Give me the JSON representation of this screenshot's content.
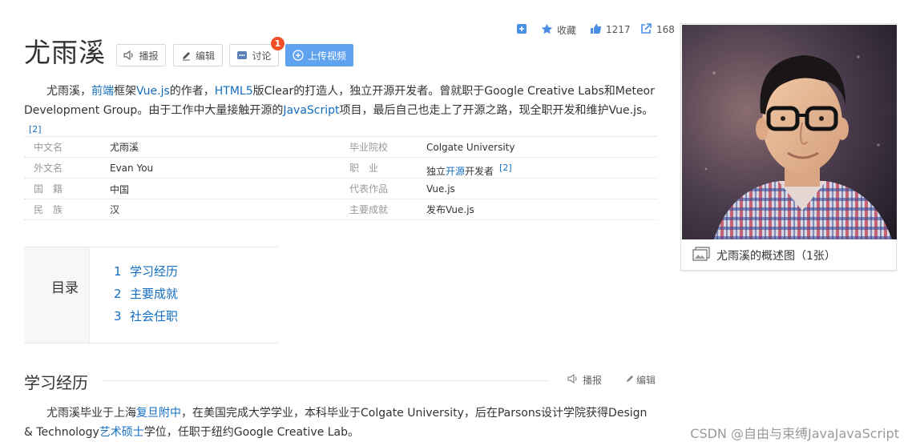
{
  "header": {
    "title": "尤雨溪",
    "buttons": {
      "broadcast": "播报",
      "edit": "编辑",
      "discuss": "讨论",
      "discuss_badge": "1",
      "upload_video": "上传视频"
    }
  },
  "topbar": {
    "favorite_label": "收藏",
    "like_count": "1217",
    "share_count": "168"
  },
  "summary": {
    "t1": "尤雨溪，",
    "l1": "前端",
    "t2": "框架",
    "l2": "Vue.js",
    "t3": "的作者，",
    "l3": "HTML5",
    "t4": "版Clear的打造人，独立开源开发者。曾就职于Google Creative Labs和Meteor Development Group。由于工作中大量接触开源的",
    "l4": "JavaScript",
    "t5": "项目，最后自己也走上了开源之路，现全职开发和维护Vue.js。",
    "ref": "[2]"
  },
  "info": {
    "rows": [
      {
        "k1": "中文名",
        "v1": "尤雨溪",
        "k2": "毕业院校",
        "v2": "Colgate University"
      },
      {
        "k1": "外文名",
        "v1": "Evan You",
        "k2": "职　业",
        "v2a": "独立",
        "v2link": "开源",
        "v2b": "开发者",
        "ref": "[2]"
      },
      {
        "k1": "国　籍",
        "v1": "中国",
        "k2": "代表作品",
        "v2": "Vue.js"
      },
      {
        "k1": "民　族",
        "v1": "汉",
        "k2": "主要成就",
        "v2": "发布Vue.js"
      }
    ]
  },
  "toc": {
    "title": "目录",
    "items": [
      {
        "num": "1",
        "label": "学习经历"
      },
      {
        "num": "2",
        "label": "主要成就"
      },
      {
        "num": "3",
        "label": "社会任职"
      }
    ]
  },
  "section": {
    "title": "学习经历",
    "broadcast": "播报",
    "edit": "编辑",
    "t1": "尤雨溪毕业于上海",
    "l1": "复旦附中",
    "t2": "，在美国完成大学学业，本科毕业于Colgate University，后在Parsons设计学院获得Design & Technology",
    "l2": "艺术硕士",
    "t3": "学位，任职于纽约Google Creative Lab。"
  },
  "album": {
    "caption": "尤雨溪的概述图（1张）"
  },
  "watermark": "CSDN @自由与束缚JavaJavaScript",
  "colors": {
    "link": "#136ec2",
    "primary_button": "#5fa2f0",
    "badge": "#f04e23",
    "icon_blue": "#4a8ee8"
  },
  "icons": [
    "speaker-icon",
    "pencil-icon",
    "chat-icon",
    "plus-circle-icon",
    "plus-square-icon",
    "star-icon",
    "thumb-up-icon",
    "share-icon",
    "picture-icon"
  ]
}
